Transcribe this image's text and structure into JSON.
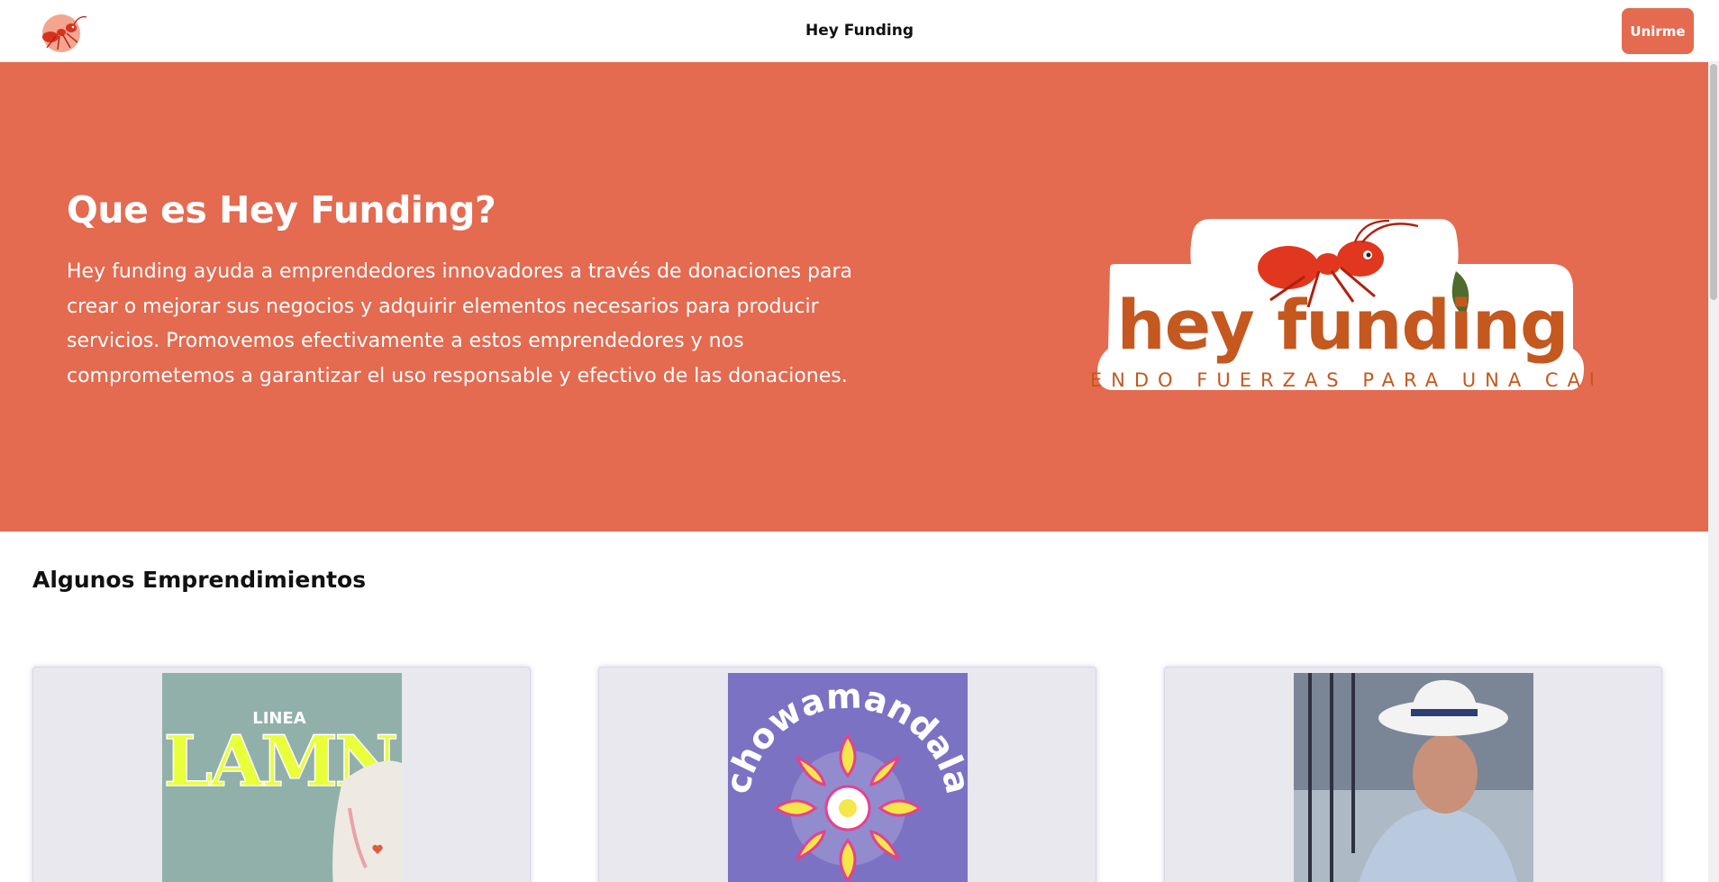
{
  "nav": {
    "title": "Hey Funding",
    "join_label": "Unirme"
  },
  "hero": {
    "title": "Que es Hey Funding?",
    "description": "Hey funding ayuda a emprendedores innovadores a través de donaciones para crear o mejorar sus negocios y adquirir elementos necesarios para producir servicios. Promovemos efectivamente a estos emprendedores y nos comprometemos a garantizar el uso responsable y efectivo de las donaciones.",
    "logo": {
      "wordmark": "hey funding",
      "tagline": "UNIENDO FUERZAS PARA UNA CAUSA"
    }
  },
  "projects": {
    "section_title": "Algunos Emprendimientos",
    "cards": [
      {
        "image_text_top": "LINEA",
        "image_text_main": "LAMN"
      },
      {
        "image_text": "chowamandala"
      },
      {
        "image": "photo-of-man-in-hat"
      }
    ]
  },
  "colors": {
    "accent": "#e46a50",
    "logo_brown": "#c4581e",
    "card_bg": "#e8e8ee"
  }
}
